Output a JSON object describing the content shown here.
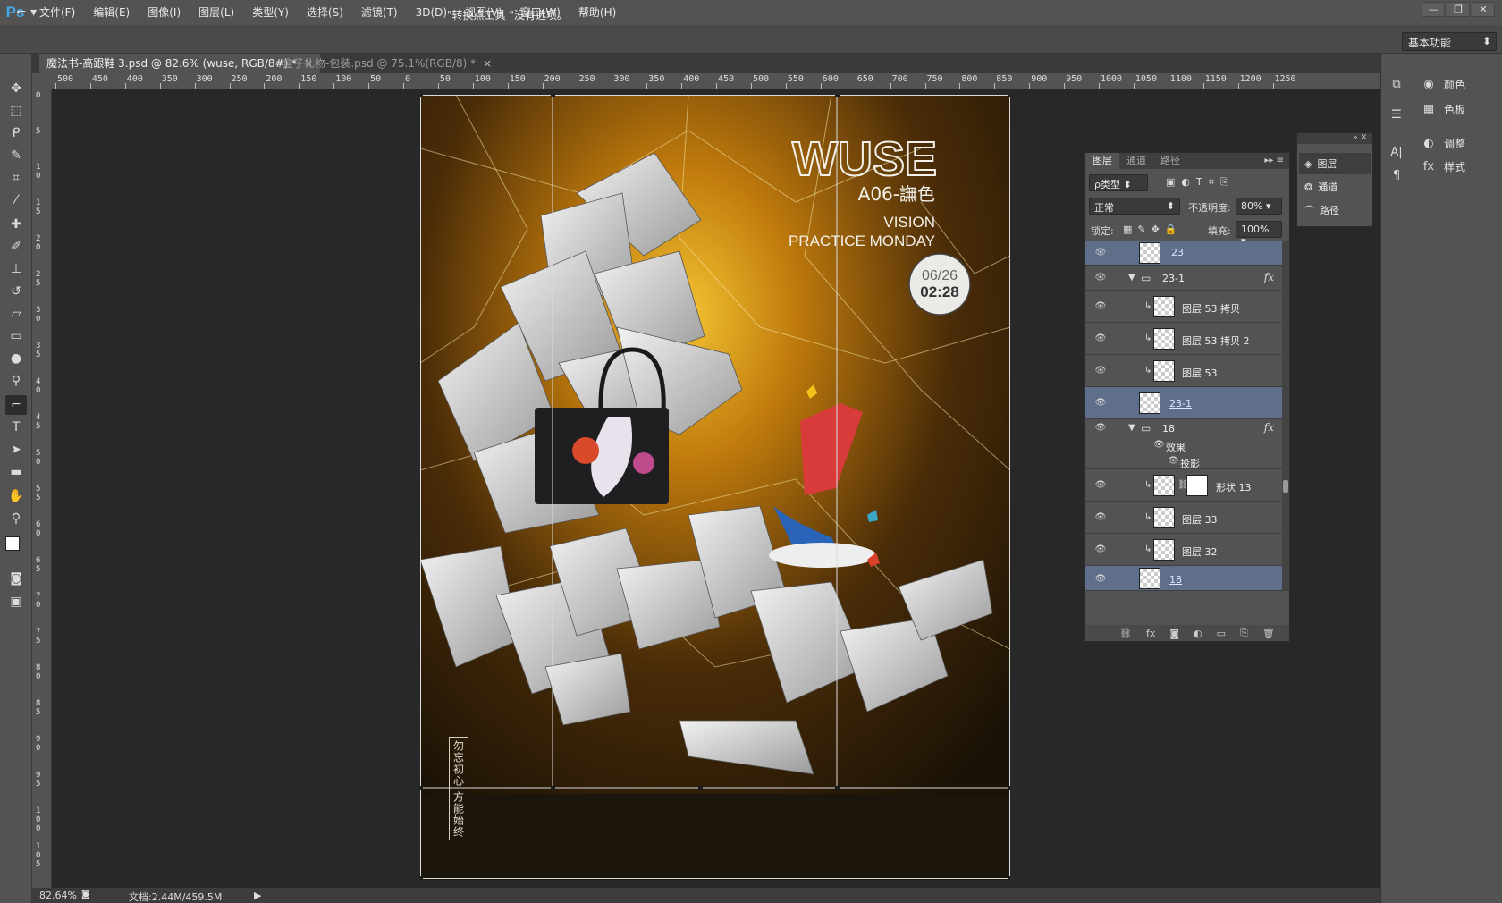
{
  "app": {
    "logo": "Ps",
    "accent": "#45a8e8"
  },
  "menu": [
    "文件(F)",
    "编辑(E)",
    "图像(I)",
    "图层(L)",
    "类型(Y)",
    "选择(S)",
    "滤镜(T)",
    "3D(D)",
    "视图(V)",
    "窗口(W)",
    "帮助(H)"
  ],
  "options": {
    "hint": "\"转换点工具 \"没有选项。",
    "workspace": "基本功能"
  },
  "tabs": [
    {
      "label": "魔法书-高跟鞋 3.psd @ 82.6% (wuse, RGB/8#) *",
      "active": true
    },
    {
      "label": "盒子礼物-包装.psd @ 75.1%(RGB/8) *",
      "active": false
    }
  ],
  "ruler": {
    "h_labels": [
      "500",
      "450",
      "400",
      "350",
      "300",
      "250",
      "200",
      "150",
      "100",
      "50",
      "0",
      "50",
      "100",
      "150",
      "200",
      "250",
      "300",
      "350",
      "400",
      "450",
      "500",
      "550",
      "600",
      "650",
      "700",
      "750",
      "800",
      "850",
      "900",
      "950",
      "1000",
      "1050",
      "1100",
      "1150",
      "1200",
      "1250"
    ],
    "v_labels": [
      "0",
      "5",
      "1\n0",
      "1\n5",
      "2\n0",
      "2\n5",
      "3\n0",
      "3\n5",
      "4\n0",
      "4\n5",
      "5\n0",
      "5\n5",
      "6\n0",
      "6\n5",
      "7\n0",
      "7\n5",
      "8\n0",
      "8\n5",
      "9\n0",
      "9\n5",
      "1\n0\n0",
      "1\n0\n5"
    ]
  },
  "poster": {
    "brand": "WUSE",
    "code": "A06-譕色",
    "line1": "VISION",
    "line2": "PRACTICE MONDAY",
    "date": "06/26",
    "time": "02:28",
    "vertical_text": "勿忘初心 方能始终",
    "bg_color": "#c07a0c"
  },
  "status": {
    "zoom": "82.64%",
    "doc": "文档:2.44M/459.5M"
  },
  "dock": {
    "color": "颜色",
    "swatches": "色板",
    "adjust": "调整",
    "styles": "样式"
  },
  "mini_panel": {
    "layers": "图层",
    "channels": "通道",
    "paths": "路径"
  },
  "layers_panel": {
    "tabs": [
      "图层",
      "通道",
      "路径"
    ],
    "filter": "ρ类型",
    "blend": "正常",
    "opacity_label": "不透明度:",
    "opacity": "80%",
    "lock_label": "锁定:",
    "fill_label": "填充:",
    "fill": "100%",
    "layers": [
      {
        "name": "23",
        "kind": "shape-selected"
      },
      {
        "name": "23-1",
        "kind": "group"
      },
      {
        "name": "图层 53 拷贝",
        "kind": "clip"
      },
      {
        "name": "图层 53 拷贝 2",
        "kind": "clip"
      },
      {
        "name": "图层 53",
        "kind": "clip"
      },
      {
        "name": "23-1",
        "kind": "shape-selected"
      },
      {
        "name": "18",
        "kind": "group"
      },
      {
        "name": "效果",
        "kind": "effect"
      },
      {
        "name": "投影",
        "kind": "effect-sub"
      },
      {
        "name": "形状 13",
        "kind": "clip-mask"
      },
      {
        "name": "图层 33",
        "kind": "clip"
      },
      {
        "name": "图层 32",
        "kind": "clip"
      },
      {
        "name": "18",
        "kind": "shape-selected"
      }
    ]
  }
}
